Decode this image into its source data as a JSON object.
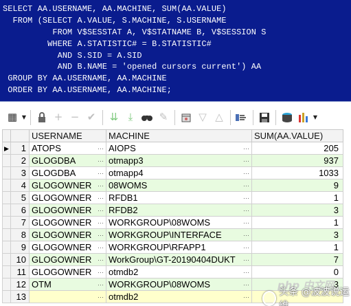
{
  "sql_editor": {
    "lines": [
      "SELECT AA.USERNAME, AA.MACHINE, SUM(AA.VALUE)",
      "  FROM (SELECT A.VALUE, S.MACHINE, S.USERNAME",
      "          FROM V$SESSTAT A, V$STATNAME B, V$SESSION S",
      "         WHERE A.STATISTIC# = B.STATISTIC#",
      "           AND S.SID = A.SID",
      "           AND B.NAME = 'opened cursors current') AA",
      " GROUP BY AA.USERNAME, AA.MACHINE",
      " ORDER BY AA.USERNAME, AA.MACHINE;"
    ]
  },
  "toolbar": {
    "buttons": [
      {
        "name": "grid-options-icon",
        "glyph": "▦"
      },
      {
        "name": "lock-icon",
        "glyph": "🔒"
      },
      {
        "name": "add-record-icon",
        "glyph": "+"
      },
      {
        "name": "delete-record-icon",
        "glyph": "−"
      },
      {
        "name": "post-changes-icon",
        "glyph": "✔"
      },
      {
        "name": "fetch-next-icon",
        "glyph": "⇊"
      },
      {
        "name": "fetch-last-icon",
        "glyph": "⤓"
      },
      {
        "name": "find-icon",
        "glyph": "⌕"
      },
      {
        "name": "clear-icon",
        "glyph": "✎"
      },
      {
        "name": "query-by-example-icon",
        "glyph": "⌂"
      },
      {
        "name": "filter-icon",
        "glyph": "▽"
      },
      {
        "name": "sort-icon",
        "glyph": "△"
      },
      {
        "name": "export-icon",
        "glyph": "⇉"
      },
      {
        "name": "save-icon",
        "glyph": "💾"
      },
      {
        "name": "print-icon",
        "glyph": "⎙"
      },
      {
        "name": "chart-icon",
        "glyph": "▮"
      }
    ]
  },
  "grid": {
    "columns": [
      "USERNAME",
      "MACHINE",
      "SUM(AA.VALUE)"
    ],
    "rows": [
      {
        "num": "1",
        "username": "ATOPS",
        "machine": "AIOPS",
        "sum": "205"
      },
      {
        "num": "2",
        "username": "GLOGDBA",
        "machine": "otmapp3",
        "sum": "937"
      },
      {
        "num": "3",
        "username": "GLOGDBA",
        "machine": "otmapp4",
        "sum": "1033"
      },
      {
        "num": "4",
        "username": "GLOGOWNER",
        "machine": "08WOMS",
        "sum": "9"
      },
      {
        "num": "5",
        "username": "GLOGOWNER",
        "machine": "RFDB1",
        "sum": "1"
      },
      {
        "num": "6",
        "username": "GLOGOWNER",
        "machine": "RFDB2",
        "sum": "3"
      },
      {
        "num": "7",
        "username": "GLOGOWNER",
        "machine": "WORKGROUP\\08WOMS",
        "sum": "1"
      },
      {
        "num": "8",
        "username": "GLOGOWNER",
        "machine": "WORKGROUP\\INTERFACE",
        "sum": "3"
      },
      {
        "num": "9",
        "username": "GLOGOWNER",
        "machine": "WORKGROUP\\RFAPP1",
        "sum": "1"
      },
      {
        "num": "10",
        "username": "GLOGOWNER",
        "machine": "WorkGroup\\GT-20190404DUKT",
        "sum": "7"
      },
      {
        "num": "11",
        "username": "GLOGOWNER",
        "machine": "otmdb2",
        "sum": "0"
      },
      {
        "num": "12",
        "username": "OTM",
        "machine": "WORKGROUP\\08WOMS",
        "sum": "3"
      },
      {
        "num": "13",
        "username": "",
        "machine": "otmdb2",
        "sum": ""
      }
    ]
  },
  "watermark": {
    "text": "头条 @波波说运维",
    "php": "php 中文网"
  }
}
